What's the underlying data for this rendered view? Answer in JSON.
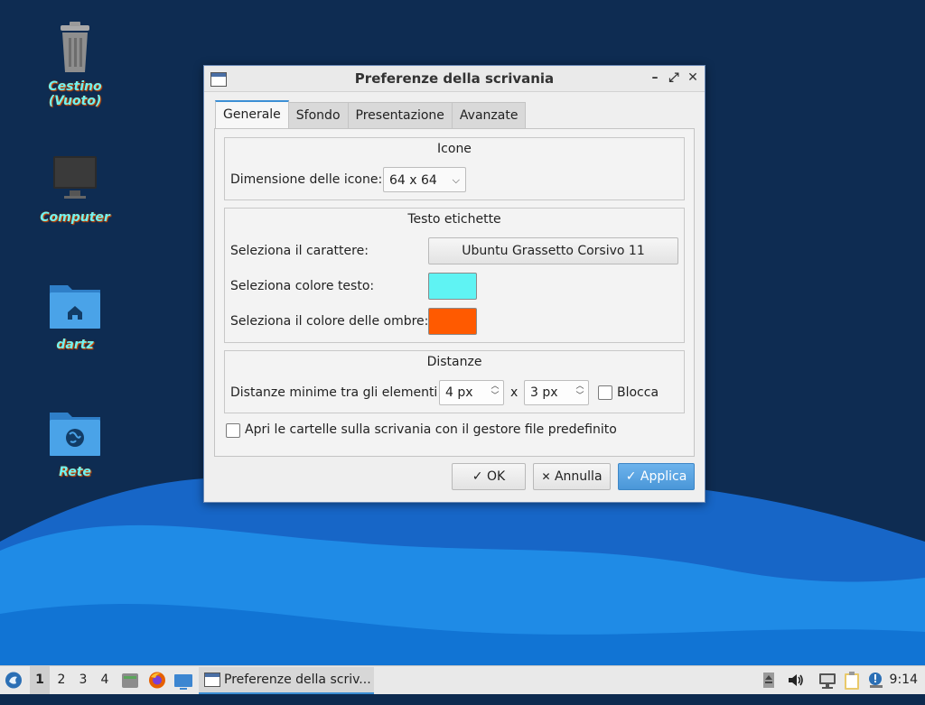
{
  "desktop": {
    "icons": [
      {
        "label": "Cestino (Vuoto)",
        "icon": "trash-icon"
      },
      {
        "label": "Computer",
        "icon": "computer-icon"
      },
      {
        "label": "dartz",
        "icon": "home-folder-icon"
      },
      {
        "label": "Rete",
        "icon": "network-folder-icon"
      }
    ]
  },
  "window": {
    "title": "Preferenze della scrivania",
    "tabs": [
      {
        "label": "Generale",
        "active": true
      },
      {
        "label": "Sfondo",
        "active": false
      },
      {
        "label": "Presentazione",
        "active": false
      },
      {
        "label": "Avanzate",
        "active": false
      }
    ],
    "icons_section": {
      "title": "Icone",
      "size_label": "Dimensione delle icone:",
      "size_value": "64 x 64"
    },
    "text_section": {
      "title": "Testo etichette",
      "font_label": "Seleziona il carattere:",
      "font_value": "Ubuntu Grassetto Corsivo 11",
      "text_color_label": "Seleziona colore testo:",
      "text_color": "#5ff3f3",
      "shadow_color_label": "Seleziona il colore delle ombre:",
      "shadow_color": "#ff5a00"
    },
    "spacing_section": {
      "title": "Distanze",
      "min_label": "Distanze minime tra gli elementi:",
      "x_value": "4 px",
      "separator": "x",
      "y_value": "3 px",
      "lock_label": "Blocca",
      "lock_checked": false
    },
    "open_folders": {
      "label": "Apri le cartelle sulla scrivania con il gestore file predefinito",
      "checked": false
    },
    "buttons": {
      "ok": "OK",
      "cancel": "Annulla",
      "apply": "Applica"
    }
  },
  "taskbar": {
    "workspaces": [
      "1",
      "2",
      "3",
      "4"
    ],
    "active_workspace": "1",
    "task_label": "Preferenze della scriv...",
    "clock": "9:14"
  }
}
